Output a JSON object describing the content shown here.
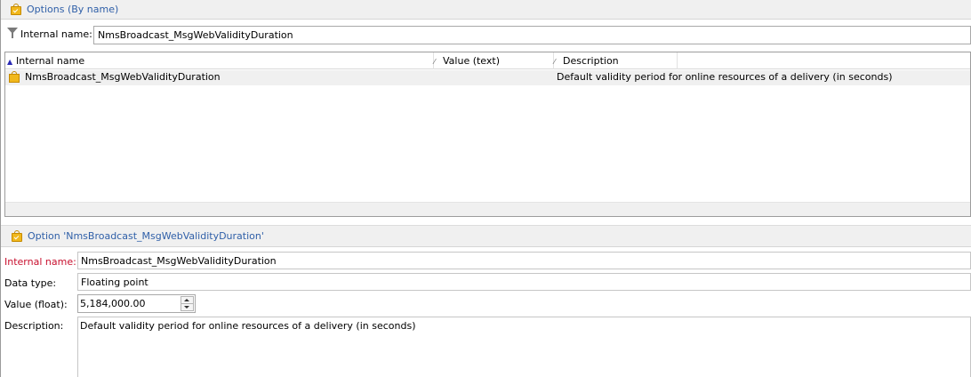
{
  "list_header": {
    "title": "Options (By name)"
  },
  "filter": {
    "label": "Internal name:",
    "value": "NmsBroadcast_MsgWebValidityDuration"
  },
  "grid": {
    "columns": [
      {
        "label": "Internal name"
      },
      {
        "label": "Value (text)"
      },
      {
        "label": "Description"
      }
    ],
    "rows": [
      {
        "internal_name": "NmsBroadcast_MsgWebValidityDuration",
        "value_text": "",
        "description": "Default validity period for online resources of a delivery (in seconds)"
      }
    ]
  },
  "detail_header": {
    "title": "Option 'NmsBroadcast_MsgWebValidityDuration'"
  },
  "form": {
    "internal_name_label": "Internal name:",
    "internal_name_value": "NmsBroadcast_MsgWebValidityDuration",
    "data_type_label": "Data type:",
    "data_type_value": "Floating point",
    "value_label": "Value (float):",
    "value_value": "5,184,000.00",
    "description_label": "Description:",
    "description_value": "Default validity period for online resources of a delivery (in seconds)"
  },
  "colors": {
    "title_blue": "#2f5fa8",
    "required_red": "#c8102e",
    "icon_yellow": "#f1b81c"
  },
  "icons": [
    "options-bag-icon",
    "filter-funnel-icon",
    "sort-ascending-icon",
    "sort-indicator-icon",
    "spin-up-icon",
    "spin-down-icon"
  ]
}
